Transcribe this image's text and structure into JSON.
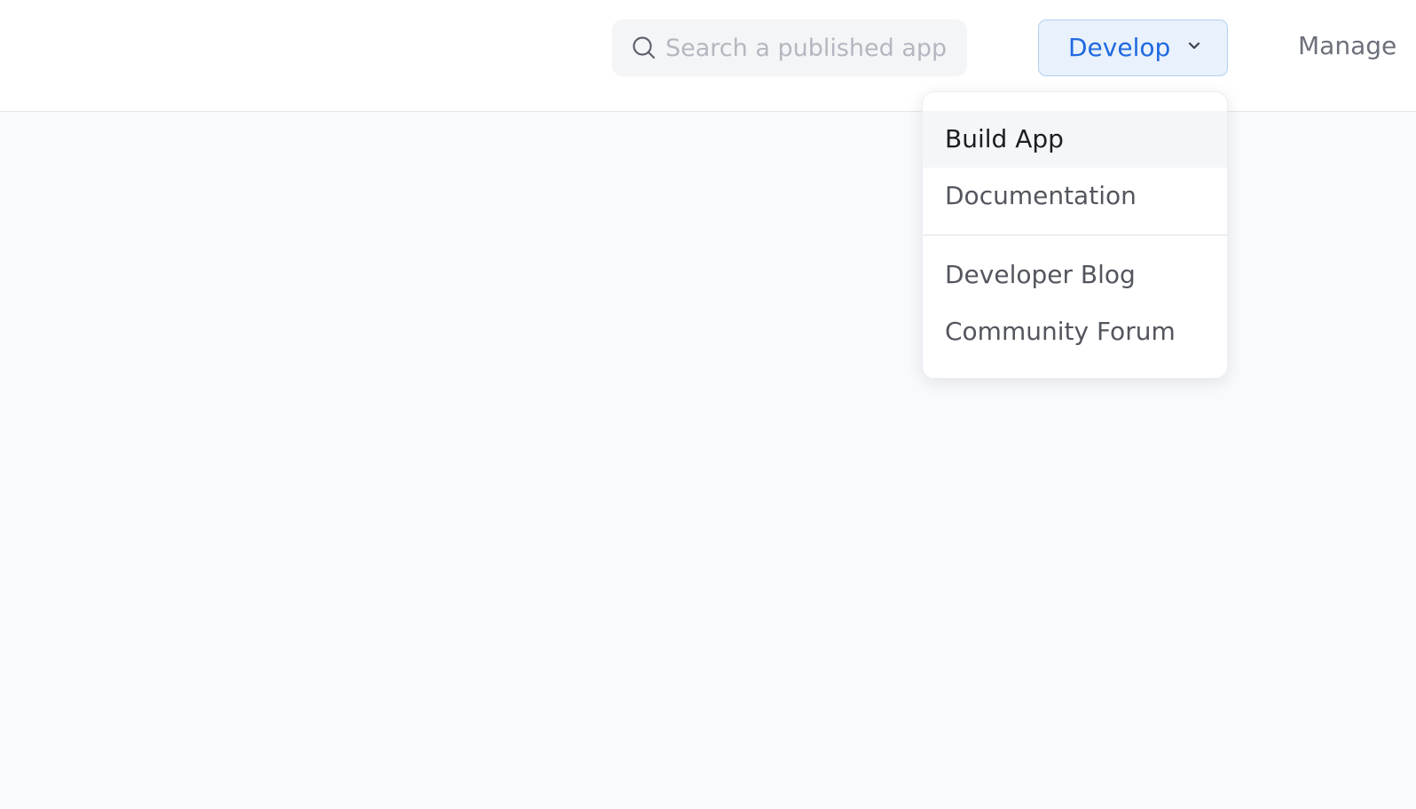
{
  "header": {
    "search": {
      "placeholder": "Search a published app",
      "value": "",
      "icon": "search-icon"
    },
    "develop_button": {
      "label": "Develop",
      "icon": "chevron-down-icon",
      "expanded": true
    },
    "manage_link": {
      "label": "Manage"
    }
  },
  "develop_menu": {
    "items": [
      {
        "label": "Build App",
        "highlighted": true
      },
      {
        "label": "Documentation"
      },
      {
        "label": "Developer Blog"
      },
      {
        "label": "Community Forum"
      }
    ]
  },
  "colors": {
    "accent": "#1f6ae0",
    "accent_bg": "#e8f1fc",
    "page_bg": "#f9fafc"
  }
}
